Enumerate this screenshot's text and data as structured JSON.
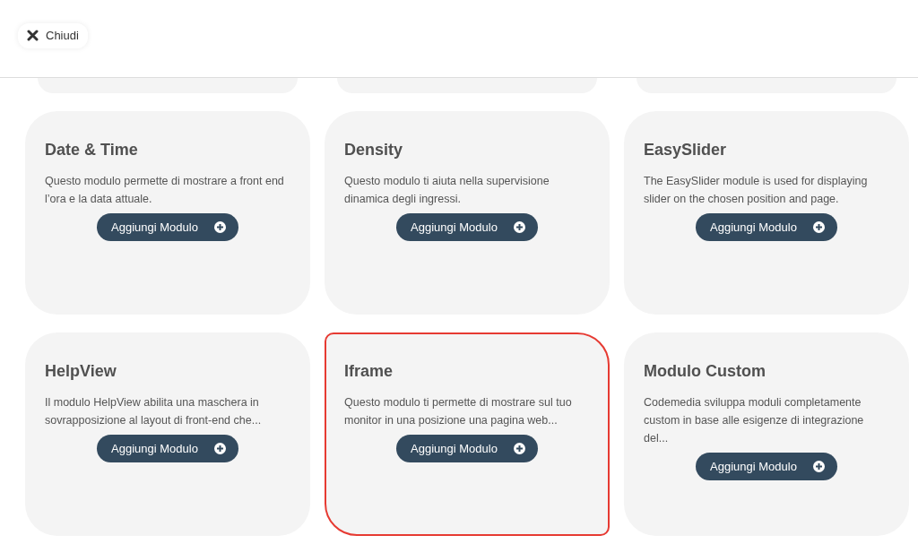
{
  "close_button": {
    "label": "Chiudi"
  },
  "modules": [
    {
      "title": "Date & Time",
      "description": "Questo modulo permette di mostrare a front end l’ora e la data attuale.",
      "button": "Aggiungi Modulo",
      "selected": false
    },
    {
      "title": "Density",
      "description": "Questo modulo ti aiuta nella supervisione dinamica degli ingressi.",
      "button": "Aggiungi Modulo",
      "selected": false
    },
    {
      "title": "EasySlider",
      "description": "The EasySlider module is used for displaying slider on the chosen position and page.",
      "button": "Aggiungi Modulo",
      "selected": false
    },
    {
      "title": "HelpView",
      "description": "Il modulo HelpView abilita una maschera in sovrapposizione al layout di front-end che...",
      "button": "Aggiungi Modulo",
      "selected": false
    },
    {
      "title": "Iframe",
      "description": "Questo modulo ti permette di mostrare sul tuo monitor in una posizione una pagina web...",
      "button": "Aggiungi Modulo",
      "selected": true
    },
    {
      "title": "Modulo Custom",
      "description": "Codemedia sviluppa moduli completamente custom in base alle esigenze di integrazione del...",
      "button": "Aggiungi Modulo",
      "selected": false
    }
  ]
}
